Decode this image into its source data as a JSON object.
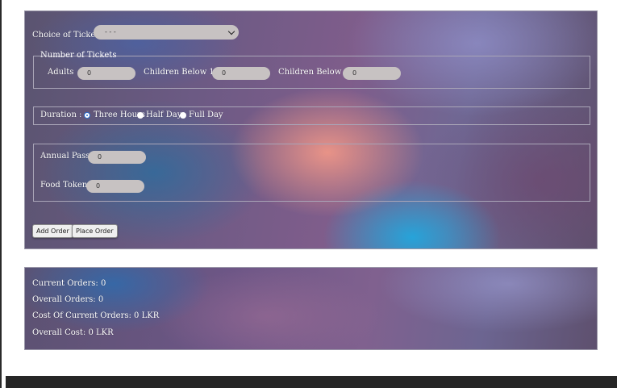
{
  "order_form": {
    "ticket_choice": {
      "label": "Choice of Ticket",
      "selected": "- - -"
    },
    "number_of_tickets": {
      "legend": "Number of Tickets",
      "adults_label": "Adults",
      "adults_value": "0",
      "children15_label": "Children Below 15",
      "children15_value": "0",
      "children6_label": "Children Below 6",
      "children6_value": "0"
    },
    "duration": {
      "label": "Duration :",
      "options": [
        {
          "label": "Three Hours",
          "selected": true
        },
        {
          "label": "Half Day",
          "selected": false
        },
        {
          "label": "Full Day",
          "selected": false
        }
      ]
    },
    "extras": {
      "annual_pass_label": "Annual Pass",
      "annual_pass_value": "0",
      "food_token_label": "Food Token",
      "food_token_value": "0"
    },
    "buttons": {
      "add_order": "Add Order",
      "place_order": "Place Order"
    }
  },
  "summary": {
    "current_orders": "Current Orders: 0",
    "overall_orders": "Overall Orders: 0",
    "cost_current": "Cost Of Current Orders: 0 LKR",
    "overall_cost": "Overall Cost: 0 LKR"
  }
}
